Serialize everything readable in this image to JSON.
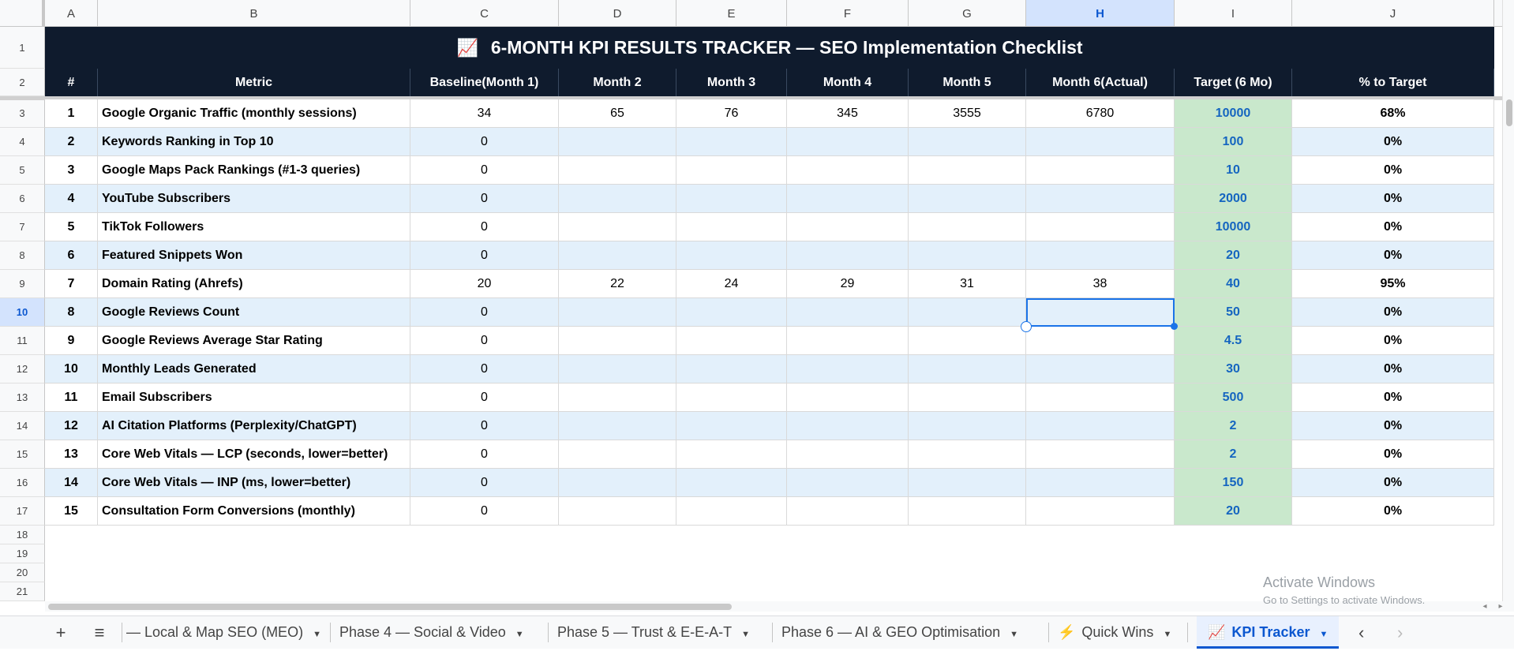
{
  "sheet": {
    "columns": [
      "A",
      "B",
      "C",
      "D",
      "E",
      "F",
      "G",
      "H",
      "I",
      "J"
    ],
    "selected_column": "H",
    "rows": [
      "1",
      "2",
      "3",
      "4",
      "5",
      "6",
      "7",
      "8",
      "9",
      "10",
      "11",
      "12",
      "13",
      "14",
      "15",
      "16",
      "17",
      "18",
      "19",
      "20",
      "21"
    ],
    "selected_row": "10",
    "title_emoji": "📈",
    "title": "6-MONTH KPI RESULTS TRACKER — SEO Implementation Checklist",
    "headers": [
      "#",
      "Metric",
      "Baseline(Month 1)",
      "Month 2",
      "Month 3",
      "Month 4",
      "Month 5",
      "Month 6(Actual)",
      "Target (6 Mo)",
      "% to Target"
    ],
    "kpi_rows": [
      {
        "num": "1",
        "metric": "Google Organic Traffic (monthly sessions)",
        "baseline": "34",
        "m2": "65",
        "m3": "76",
        "m4": "345",
        "m5": "3555",
        "m6": "6780",
        "target": "10000",
        "pct": "68%"
      },
      {
        "num": "2",
        "metric": "Keywords Ranking in Top 10",
        "baseline": "0",
        "m2": "",
        "m3": "",
        "m4": "",
        "m5": "",
        "m6": "",
        "target": "100",
        "pct": "0%"
      },
      {
        "num": "3",
        "metric": "Google Maps Pack Rankings (#1-3 queries)",
        "baseline": "0",
        "m2": "",
        "m3": "",
        "m4": "",
        "m5": "",
        "m6": "",
        "target": "10",
        "pct": "0%"
      },
      {
        "num": "4",
        "metric": "YouTube Subscribers",
        "baseline": "0",
        "m2": "",
        "m3": "",
        "m4": "",
        "m5": "",
        "m6": "",
        "target": "2000",
        "pct": "0%"
      },
      {
        "num": "5",
        "metric": "TikTok Followers",
        "baseline": "0",
        "m2": "",
        "m3": "",
        "m4": "",
        "m5": "",
        "m6": "",
        "target": "10000",
        "pct": "0%"
      },
      {
        "num": "6",
        "metric": "Featured Snippets Won",
        "baseline": "0",
        "m2": "",
        "m3": "",
        "m4": "",
        "m5": "",
        "m6": "",
        "target": "20",
        "pct": "0%"
      },
      {
        "num": "7",
        "metric": "Domain Rating (Ahrefs)",
        "baseline": "20",
        "m2": "22",
        "m3": "24",
        "m4": "29",
        "m5": "31",
        "m6": "38",
        "target": "40",
        "pct": "95%"
      },
      {
        "num": "8",
        "metric": "Google Reviews Count",
        "baseline": "0",
        "m2": "",
        "m3": "",
        "m4": "",
        "m5": "",
        "m6": "",
        "target": "50",
        "pct": "0%"
      },
      {
        "num": "9",
        "metric": "Google Reviews Average Star Rating",
        "baseline": "0",
        "m2": "",
        "m3": "",
        "m4": "",
        "m5": "",
        "m6": "",
        "target": "4.5",
        "pct": "0%"
      },
      {
        "num": "10",
        "metric": "Monthly Leads Generated",
        "baseline": "0",
        "m2": "",
        "m3": "",
        "m4": "",
        "m5": "",
        "m6": "",
        "target": "30",
        "pct": "0%"
      },
      {
        "num": "11",
        "metric": "Email Subscribers",
        "baseline": "0",
        "m2": "",
        "m3": "",
        "m4": "",
        "m5": "",
        "m6": "",
        "target": "500",
        "pct": "0%"
      },
      {
        "num": "12",
        "metric": "AI Citation Platforms (Perplexity/ChatGPT)",
        "baseline": "0",
        "m2": "",
        "m3": "",
        "m4": "",
        "m5": "",
        "m6": "",
        "target": "2",
        "pct": "0%"
      },
      {
        "num": "13",
        "metric": "Core Web Vitals — LCP (seconds, lower=better)",
        "baseline": "0",
        "m2": "",
        "m3": "",
        "m4": "",
        "m5": "",
        "m6": "",
        "target": "2",
        "pct": "0%"
      },
      {
        "num": "14",
        "metric": "Core Web Vitals — INP (ms, lower=better)",
        "baseline": "0",
        "m2": "",
        "m3": "",
        "m4": "",
        "m5": "",
        "m6": "",
        "target": "150",
        "pct": "0%"
      },
      {
        "num": "15",
        "metric": "Consultation Form Conversions (monthly)",
        "baseline": "0",
        "m2": "",
        "m3": "",
        "m4": "",
        "m5": "",
        "m6": "",
        "target": "20",
        "pct": "0%"
      }
    ]
  },
  "watermark": {
    "line1": "Activate Windows",
    "line2": "Go to Settings to activate Windows."
  },
  "tabs": {
    "add_icon": "+",
    "list_icon": "≡",
    "items": [
      {
        "label": "— Local & Map SEO (MEO)",
        "icon": ""
      },
      {
        "label": "Phase 4 — Social & Video",
        "icon": ""
      },
      {
        "label": "Phase 5 — Trust & E-E-A-T",
        "icon": ""
      },
      {
        "label": "Phase 6 — AI & GEO Optimisation",
        "icon": ""
      },
      {
        "label": "Quick Wins",
        "icon": "⚡"
      },
      {
        "label": "KPI Tracker",
        "icon": "📈"
      }
    ],
    "active": "KPI Tracker",
    "nav_left": "‹",
    "nav_right": "›"
  },
  "colors": {
    "header_bg": "#0f1b2d",
    "row_alt": "#e3f0fb",
    "target_bg": "#c9e8cc",
    "target_text": "#1565c0",
    "selection": "#1a73e8"
  }
}
